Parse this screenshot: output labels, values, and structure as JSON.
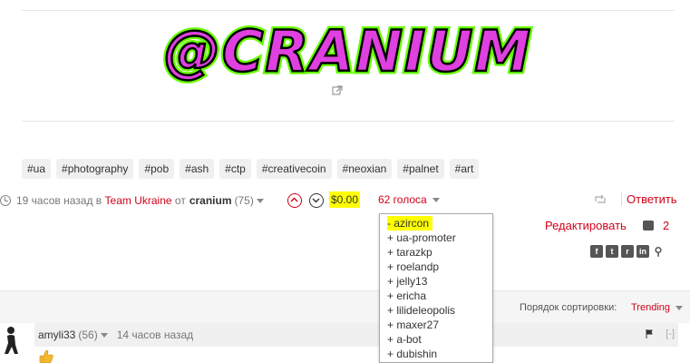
{
  "banner_text": "@CRANIUM",
  "tags": [
    "#ua",
    "#photography",
    "#pob",
    "#ash",
    "#ctp",
    "#creativecoin",
    "#neoxian",
    "#palnet",
    "#art"
  ],
  "meta": {
    "time": "19 часов назад в",
    "community": "Team Ukraine",
    "by": "от",
    "author": "cranium",
    "reputation": "(75)"
  },
  "payout": "$0.00",
  "votes_label": "62 голоса",
  "actions": {
    "reply": "Ответить",
    "edit": "Редактировать",
    "comments_count": "2"
  },
  "voters": [
    "- azircon",
    "+ ua-promoter",
    "+ tarazkp",
    "+ roelandp",
    "+ jelly13",
    "+ ericha",
    "+ lilideleopolis",
    "+ maxer27",
    "+ a-bot",
    "+ dubishin"
  ],
  "comments_section": {
    "sort_label": "Порядок сортировки:",
    "sort_value": "Trending"
  },
  "comment": {
    "author": "amyli33",
    "reputation": "(56)",
    "time": "14 часов назад",
    "collapse": "[-]"
  },
  "colors": {
    "accent": "#d0021b",
    "highlight": "#ffff00",
    "banner_fill": "#e040e0",
    "banner_glow": "#66ff00"
  }
}
